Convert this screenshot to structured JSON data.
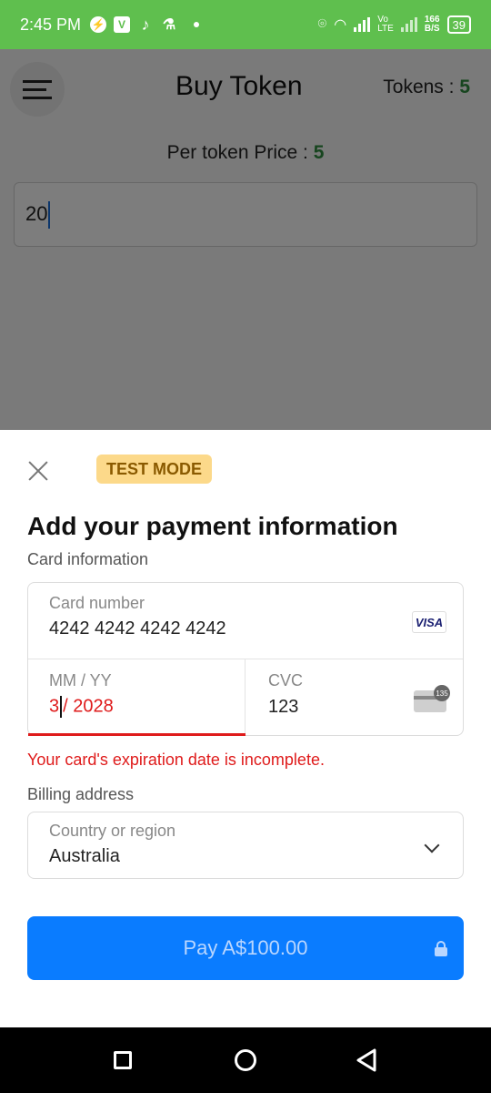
{
  "status_bar": {
    "time": "2:45 PM",
    "network_speed_value": "166",
    "network_speed_unit": "B/S",
    "network_label_top": "Vo",
    "network_label_bottom": "LTE",
    "battery": "39",
    "icons": [
      "messenger-icon",
      "v-app-icon",
      "tiktok-icon",
      "flask-icon",
      "notification-dot",
      "location-icon",
      "wifi-icon",
      "signal-icon",
      "volte-icon",
      "signal-icon-2",
      "battery-icon"
    ]
  },
  "app": {
    "title": "Buy Token",
    "tokens_label": "Tokens : ",
    "tokens_value": "5",
    "price_label": "Per token Price : ",
    "price_value": "5",
    "amount_value": "20",
    "accent_green": "#2e8b3e"
  },
  "sheet": {
    "test_mode": "TEST MODE",
    "title": "Add your payment information",
    "card_info_label": "Card information",
    "card_number_label": "Card number",
    "card_number_value": "4242 4242 4242 4242",
    "card_brand": "VISA",
    "expiry_label": "MM / YY",
    "expiry_month": "3",
    "expiry_rest": "/ 2028",
    "cvc_label": "CVC",
    "cvc_value": "123",
    "cvc_icon_badge": "135",
    "error_message": "Your card's expiration date is incomplete.",
    "billing_label": "Billing address",
    "country_label": "Country or region",
    "country_value": "Australia",
    "pay_button": "Pay A$100.00",
    "error_color": "#df1b1b",
    "button_color": "#0a7cff"
  },
  "nav_bar": {
    "buttons": [
      "recents-button",
      "home-button",
      "back-button"
    ]
  }
}
